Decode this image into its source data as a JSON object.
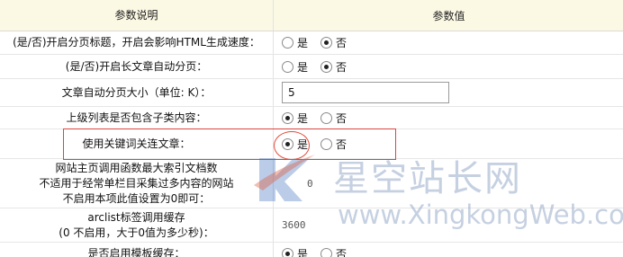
{
  "header": {
    "param_desc": "参数说明",
    "param_value": "参数值"
  },
  "rows": [
    {
      "label": "(是/否)开启分页标题，开启会影响HTML生成速度：",
      "type": "radio",
      "options": [
        "是",
        "否"
      ],
      "selected": "否"
    },
    {
      "label": "(是/否)开启长文章自动分页：",
      "type": "radio",
      "options": [
        "是",
        "否"
      ],
      "selected": "否"
    },
    {
      "label": "文章自动分页大小（单位: K）：",
      "type": "text",
      "value": "5"
    },
    {
      "label": "上级列表是否包含子类内容：",
      "type": "radio",
      "options": [
        "是",
        "否"
      ],
      "selected": "是"
    },
    {
      "label": "使用关键词关连文章：",
      "type": "radio",
      "options": [
        "是",
        "否"
      ],
      "selected": "是"
    },
    {
      "label_lines": [
        "网站主页调用函数最大索引文档数",
        "不适用于经常单栏目采集过多内容的网站",
        "不启用本项此值设置为0即可："
      ],
      "type": "plain",
      "value": "0"
    },
    {
      "label_lines": [
        "arclist标签调用缓存",
        "(0 不启用，大于0值为多少秒)："
      ],
      "type": "plain",
      "value": "3600"
    },
    {
      "label": "是否启用模板缓存：",
      "type": "radio",
      "options": [
        "是",
        "否"
      ],
      "selected": "是"
    }
  ],
  "watermark": {
    "cn": "星空站长网",
    "url": "www.XingkongWeb.com",
    "color": "#9aaac8"
  }
}
